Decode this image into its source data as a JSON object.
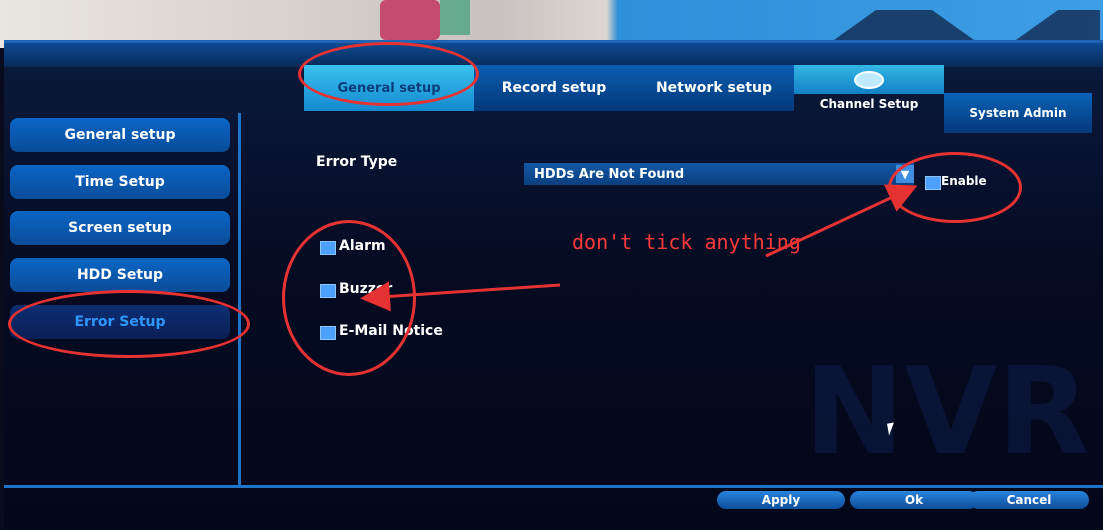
{
  "tabs": {
    "general": "General setup",
    "record": "Record setup",
    "network": "Network setup",
    "channel": "Channel Setup",
    "system_admin": "System Admin"
  },
  "sidebar": {
    "items": [
      {
        "label": "General setup"
      },
      {
        "label": "Time Setup"
      },
      {
        "label": "Screen setup"
      },
      {
        "label": "HDD Setup"
      },
      {
        "label": "Error Setup"
      }
    ],
    "active_index": 4
  },
  "form": {
    "error_type_label": "Error Type",
    "error_type_value": "HDDs Are Not Found",
    "enable_label": "Enable",
    "options": [
      {
        "label": "Alarm"
      },
      {
        "label": "Buzzer"
      },
      {
        "label": "E-Mail Notice"
      }
    ]
  },
  "annotation": {
    "text": "don't tick anything",
    "color": "#e63232"
  },
  "buttons": {
    "apply": "Apply",
    "ok": "Ok",
    "cancel": "Cancel"
  },
  "watermark": "NVR",
  "colors": {
    "accent": "#1d74c9",
    "active_tab": "#3ac2ef",
    "annotation": "#e63232"
  }
}
